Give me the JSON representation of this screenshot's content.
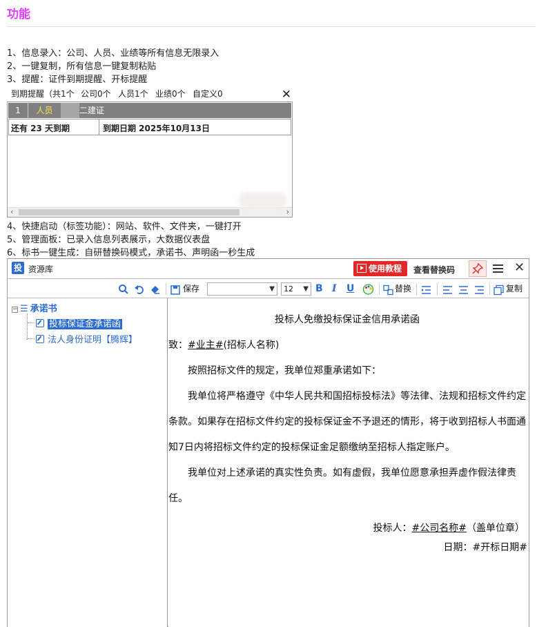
{
  "page": {
    "title": "功能",
    "lines": [
      "1、信息录入：公司、人员、业绩等所有信息无限录入",
      "2、一键复制，所有信息一键复制粘贴",
      "3、提醒：证件到期提醒、开标提醒",
      "4、快捷启动（标签功能）：网站、软件、文件夹，一键打开",
      "5、管理面板：已录入信息列表展示，大数据仪表盘",
      "6、标书一键生成：自研替换码模式，承诺书、声明函一秒生成"
    ]
  },
  "reminder": {
    "tabs": [
      "到期提醒（共1个",
      "公司0个",
      "人员1个",
      "业绩0个",
      "自定义0"
    ],
    "close": "✕",
    "row": {
      "index": "1",
      "category": "人员",
      "cert": "二建证"
    },
    "detail": {
      "remaining": "还有 23 天到期",
      "due": "到期日期 2025年10月13日"
    },
    "scroll_left": "‹",
    "scroll_right": "›"
  },
  "window": {
    "logo": "投",
    "title": "资源库",
    "tutorial_button": "使用教程",
    "view_codes_button": "查看替换码",
    "toolbar": {
      "save": "保存",
      "font_size": "12",
      "replace": "替换",
      "copy": "复制"
    },
    "tree": {
      "root": "承诺书",
      "items": [
        "投标保证金承诺函",
        "法人身份证明【腾辉】"
      ]
    },
    "document": {
      "title": "投标人免缴投标保证金信用承诺函",
      "to_prefix": "致：",
      "to_code": "#业主#",
      "to_suffix": "(招标人名称)",
      "intro": "按照招标文件的规定，我单位郑重承诺如下：",
      "p1_l1": "我单位将严格遵守《中华人民共和国招标投标法》等法律、法规和招标文件约定",
      "p1_l2": "条款。如果存在招标文件约定的投标保证金不予退还的情形，将于收到招标人书面通",
      "p1_l3": "知7日内将招标文件约定的投标保证金足额缴纳至招标人指定账户。",
      "p2_l1": "我单位对上述承诺的真实性负责。如有虚假，我单位愿意承担弄虚作假法律责",
      "p2_l2": "任。",
      "sign_prefix": "投标人：",
      "sign_code": "#公司名称#",
      "sign_suffix": "（盖单位章）",
      "date": "日期：#开标日期#"
    }
  }
}
